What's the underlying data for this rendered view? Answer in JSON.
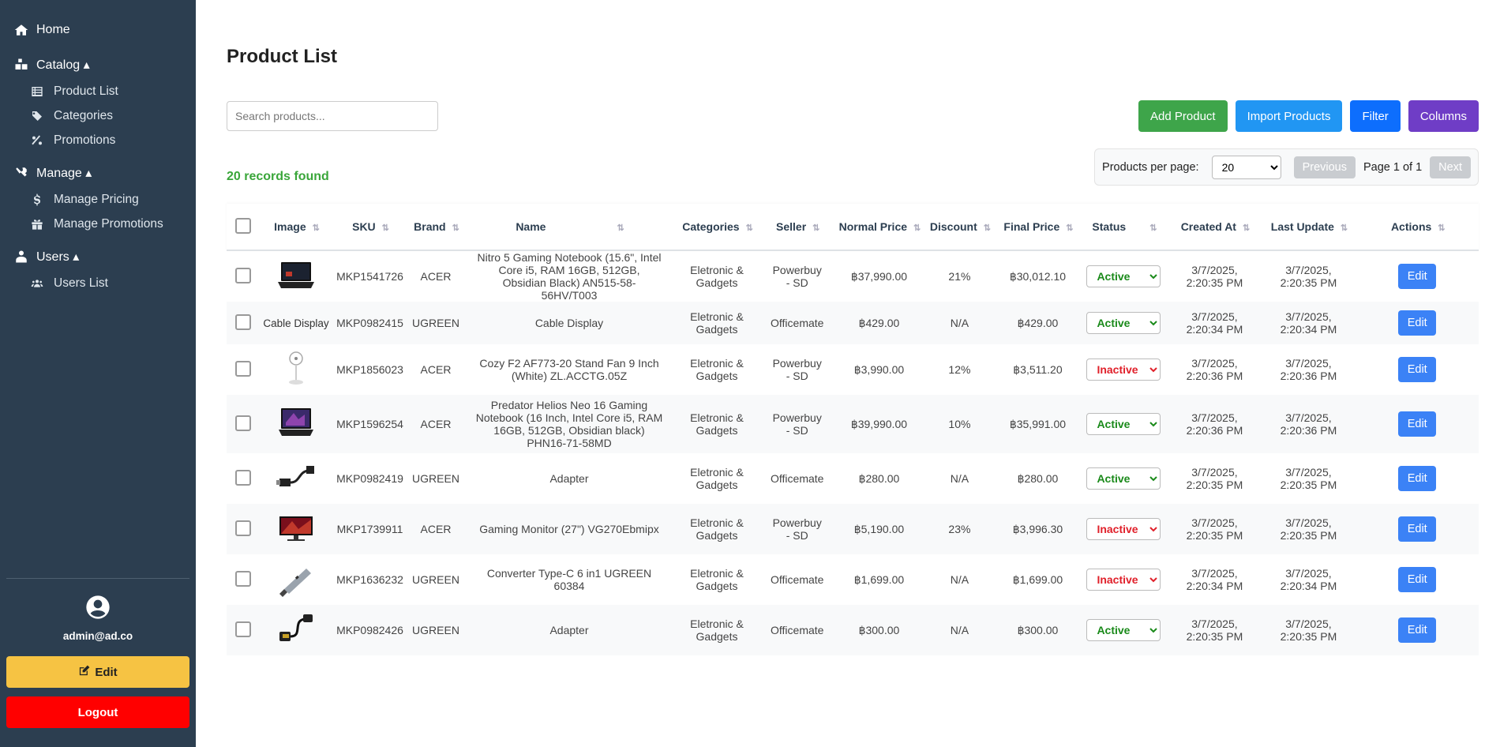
{
  "sidebar": {
    "home": "Home",
    "catalog": "Catalog ▴",
    "catalog_items": [
      "Product List",
      "Categories",
      "Promotions"
    ],
    "manage": "Manage ▴",
    "manage_items": [
      "Manage Pricing",
      "Manage Promotions"
    ],
    "users": "Users ▴",
    "users_items": [
      "Users List"
    ],
    "user_email": "admin@ad.co",
    "edit_label": "Edit",
    "logout_label": "Logout"
  },
  "main": {
    "title": "Product List",
    "search_placeholder": "Search products...",
    "buttons": {
      "add": "Add Product",
      "import": "Import Products",
      "filter": "Filter",
      "columns": "Columns"
    },
    "button_colors": {
      "add": "#3ea54a",
      "import": "#2196f3",
      "filter": "#0d6efd",
      "columns": "#6f3dc6"
    },
    "records": "20 records found",
    "pager": {
      "per_page_label": "Products per page:",
      "per_page_value": "20",
      "previous": "Previous",
      "page_label": "Page 1 of 1",
      "next": "Next"
    }
  },
  "table": {
    "headers": [
      "Image",
      "SKU",
      "Brand",
      "Name",
      "Categories",
      "Seller",
      "Normal Price",
      "Discount",
      "Final Price",
      "Status",
      "Created At",
      "Last Update",
      "Actions"
    ],
    "edit_label": "Edit",
    "rows": [
      {
        "image": "laptop",
        "sku": "MKP1541726",
        "brand": "ACER",
        "name": "Nitro 5 Gaming Notebook (15.6\", Intel Core i5, RAM 16GB, 512GB, Obsidian Black) AN515-58-56HV/T003",
        "category": "Eletronic & Gadgets",
        "seller": "Powerbuy - SD",
        "normal": "฿37,990.00",
        "discount": "21%",
        "final": "฿30,012.10",
        "status": "Active",
        "created": "3/7/2025, 2:20:35 PM",
        "updated": "3/7/2025, 2:20:35 PM"
      },
      {
        "image": "broken",
        "image_alt": "Cable Display",
        "sku": "MKP0982415",
        "brand": "UGREEN",
        "name": "Cable Display",
        "category": "Eletronic & Gadgets",
        "seller": "Officemate",
        "normal": "฿429.00",
        "discount": "N/A",
        "final": "฿429.00",
        "status": "Active",
        "created": "3/7/2025, 2:20:34 PM",
        "updated": "3/7/2025, 2:20:34 PM"
      },
      {
        "image": "fan",
        "sku": "MKP1856023",
        "brand": "ACER",
        "name": "Cozy F2 AF773-20 Stand Fan 9 Inch (White) ZL.ACCTG.05Z",
        "category": "Eletronic & Gadgets",
        "seller": "Powerbuy - SD",
        "normal": "฿3,990.00",
        "discount": "12%",
        "final": "฿3,511.20",
        "status": "Inactive",
        "created": "3/7/2025, 2:20:36 PM",
        "updated": "3/7/2025, 2:20:36 PM"
      },
      {
        "image": "laptop2",
        "sku": "MKP1596254",
        "brand": "ACER",
        "name": "Predator Helios Neo 16 Gaming Notebook (16 Inch, Intel Core i5, RAM 16GB, 512GB, Obsidian black) PHN16-71-58MD",
        "category": "Eletronic & Gadgets",
        "seller": "Powerbuy - SD",
        "normal": "฿39,990.00",
        "discount": "10%",
        "final": "฿35,991.00",
        "status": "Active",
        "created": "3/7/2025, 2:20:36 PM",
        "updated": "3/7/2025, 2:20:36 PM"
      },
      {
        "image": "adapter",
        "sku": "MKP0982419",
        "brand": "UGREEN",
        "name": "Adapter",
        "category": "Eletronic & Gadgets",
        "seller": "Officemate",
        "normal": "฿280.00",
        "discount": "N/A",
        "final": "฿280.00",
        "status": "Active",
        "created": "3/7/2025, 2:20:35 PM",
        "updated": "3/7/2025, 2:20:35 PM"
      },
      {
        "image": "monitor",
        "sku": "MKP1739911",
        "brand": "ACER",
        "name": "Gaming Monitor (27\") VG270Ebmipx",
        "category": "Eletronic & Gadgets",
        "seller": "Powerbuy - SD",
        "normal": "฿5,190.00",
        "discount": "23%",
        "final": "฿3,996.30",
        "status": "Inactive",
        "created": "3/7/2025, 2:20:35 PM",
        "updated": "3/7/2025, 2:20:35 PM"
      },
      {
        "image": "hub",
        "sku": "MKP1636232",
        "brand": "UGREEN",
        "name": "Converter Type-C 6 in1 UGREEN 60384",
        "category": "Eletronic & Gadgets",
        "seller": "Officemate",
        "normal": "฿1,699.00",
        "discount": "N/A",
        "final": "฿1,699.00",
        "status": "Inactive",
        "created": "3/7/2025, 2:20:34 PM",
        "updated": "3/7/2025, 2:20:34 PM"
      },
      {
        "image": "cable",
        "sku": "MKP0982426",
        "brand": "UGREEN",
        "name": "Adapter",
        "category": "Eletronic & Gadgets",
        "seller": "Officemate",
        "normal": "฿300.00",
        "discount": "N/A",
        "final": "฿300.00",
        "status": "Active",
        "created": "3/7/2025, 2:20:35 PM",
        "updated": "3/7/2025, 2:20:35 PM"
      }
    ]
  }
}
